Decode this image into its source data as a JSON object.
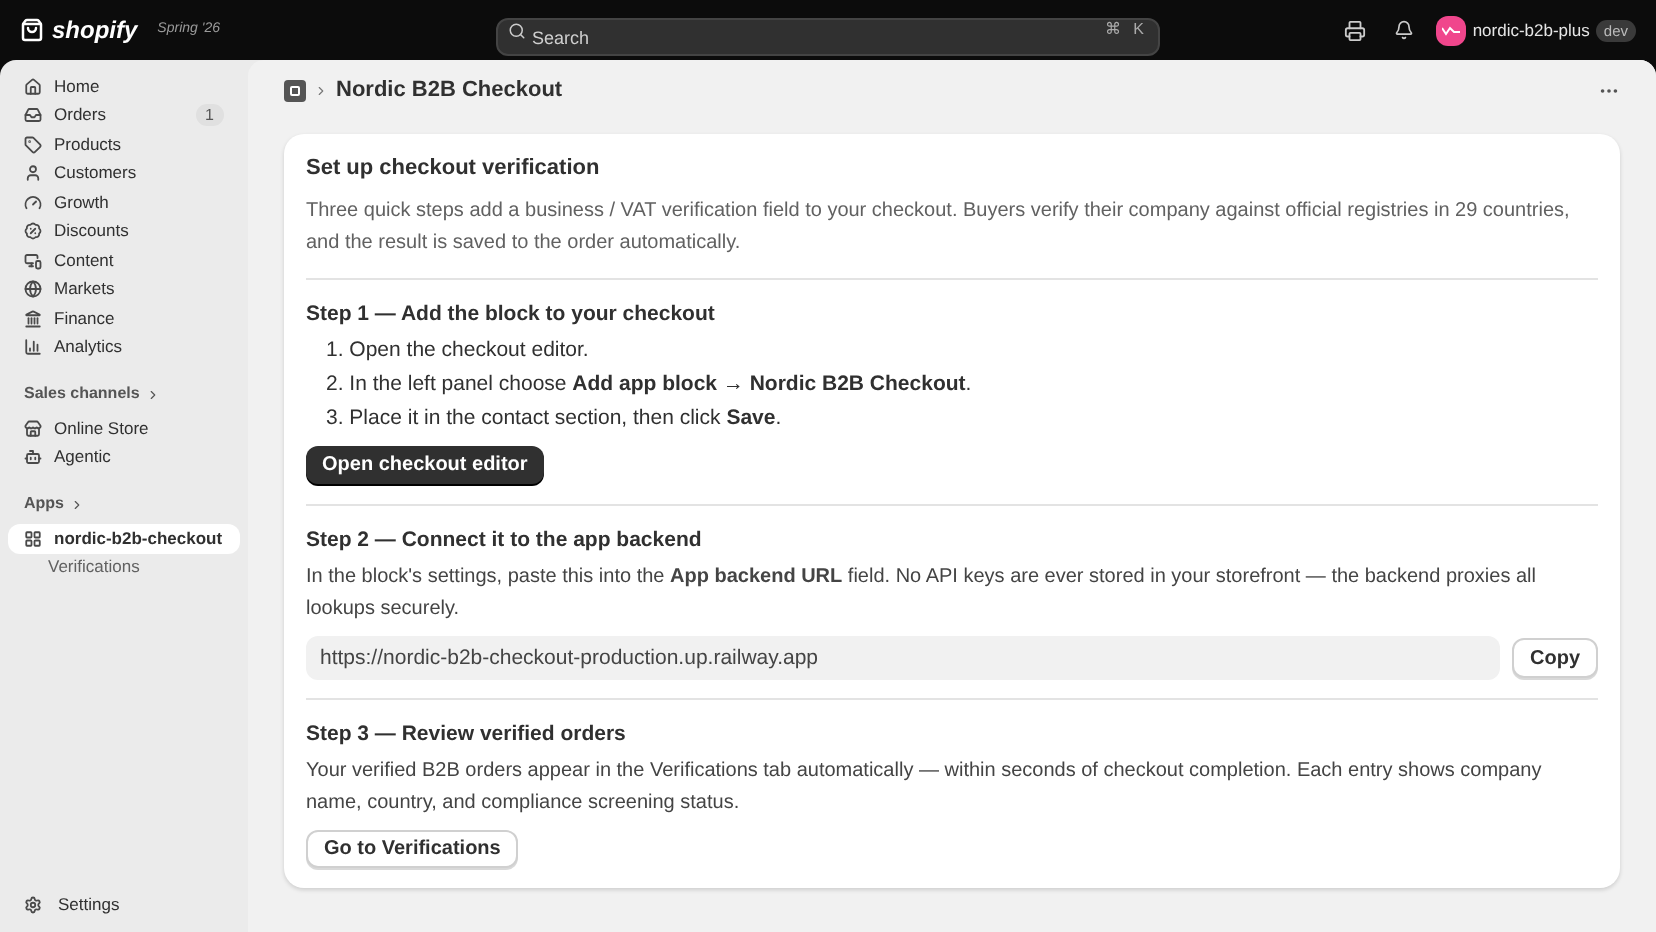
{
  "topbar": {
    "logo": "shopify",
    "edition": "Spring '26",
    "search": {
      "placeholder": "Search"
    },
    "shortcut": [
      "⌘",
      "K"
    ],
    "store": {
      "name": "nordic-b2b-plus",
      "badge": "dev"
    }
  },
  "sidebar": {
    "items": [
      {
        "label": "Home",
        "selected": false
      },
      {
        "label": "Orders",
        "badge": "1",
        "selected": false
      },
      {
        "label": "Products",
        "selected": false
      },
      {
        "label": "Customers",
        "selected": false
      },
      {
        "label": "Growth",
        "selected": false
      },
      {
        "label": "Discounts",
        "selected": false
      },
      {
        "label": "Content",
        "selected": false
      },
      {
        "label": "Markets",
        "selected": false
      },
      {
        "label": "Finance",
        "selected": false
      },
      {
        "label": "Analytics",
        "selected": false
      }
    ],
    "sections": [
      {
        "title": "Sales channels",
        "items": [
          {
            "label": "Online Store",
            "selected": false
          },
          {
            "label": "Agentic",
            "selected": false
          }
        ]
      },
      {
        "title": "Apps",
        "items": [
          {
            "label": "nordic-b2b-checkout",
            "selected": true,
            "children": [
              {
                "label": "Verifications",
                "selected": false
              }
            ]
          }
        ]
      }
    ],
    "footer": {
      "label": "Settings",
      "selected": false
    }
  },
  "page": {
    "title": "Nordic B2B Checkout"
  },
  "card": {
    "title": "Set up checkout verification",
    "intro": "Three quick steps add a business / VAT verification field to your checkout. Buyers verify their company against official registries in 29 countries, and the result is saved to the order automatically.",
    "steps": [
      {
        "kind": "list",
        "title": "Step 1 — Add the block to your checkout",
        "items": [
          "1. Open the checkout editor.",
          "2. In the left panel choose **Add app block → Nordic B2B Checkout**.",
          "3. Place it in the contact section, then click **Save**."
        ],
        "button": {
          "label": "Open checkout editor",
          "kind": "primary"
        }
      },
      {
        "kind": "copy",
        "title": "Step 2 — Connect it to the app backend",
        "text": "In the block's settings, paste this into the **App backend URL** field. No API keys are ever stored in your storefront — the backend proxies all lookups securely.",
        "url": "https://nordic-b2b-checkout-production.up.railway.app",
        "copy": "Copy"
      },
      {
        "kind": "text",
        "title": "Step 3 — Review verified orders",
        "text": "Your verified B2B orders appear in the Verifications tab automatically — within seconds of checkout completion. Each entry shows company name, country, and compliance screening status.",
        "button": {
          "label": "Go to Verifications",
          "kind": "secondary"
        }
      }
    ]
  }
}
